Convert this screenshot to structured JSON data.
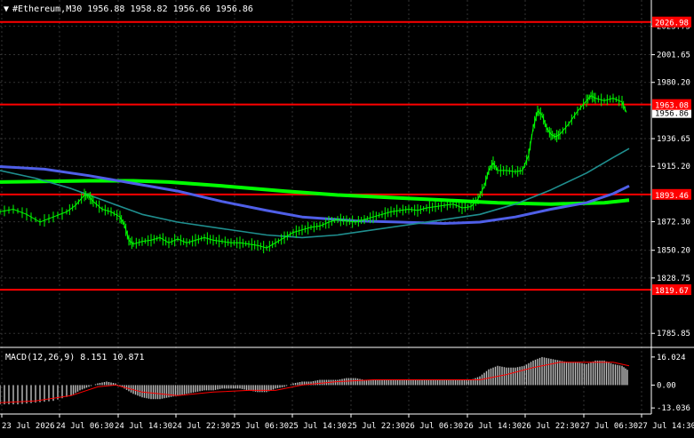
{
  "chart_data": {
    "type": "candlestick",
    "title": "#Ethereum,M30  1956.88 1958.82 1956.66 1956.86",
    "symbol": "#Ethereum",
    "timeframe": "M30",
    "ohlc": {
      "open": 1956.88,
      "high": 1958.82,
      "low": 1956.66,
      "close": 1956.86
    },
    "current_price": 1956.86,
    "ylim": [
      1775,
      2044
    ],
    "y_ticks": [
      2023.75,
      2001.65,
      1980.2,
      1936.65,
      1915.2,
      1872.3,
      1850.2,
      1828.75,
      1785.85
    ],
    "horizontal_levels": [
      {
        "label": "2026.98",
        "value": 2026.98
      },
      {
        "label": "1963.08",
        "value": 1963.08
      },
      {
        "label": "1893.46",
        "value": 1893.46
      },
      {
        "label": "1819.67",
        "value": 1819.67
      }
    ],
    "x_labels": [
      "23 Jul 2026",
      "24 Jul 06:30",
      "24 Jul 14:30",
      "24 Jul 22:30",
      "25 Jul 06:30",
      "25 Jul 14:30",
      "25 Jul 22:30",
      "26 Jul 06:30",
      "26 Jul 14:30",
      "26 Jul 22:30",
      "27 Jul 06:30",
      "27 Jul 14:30"
    ],
    "price_path": [
      [
        0,
        1880
      ],
      [
        15,
        1882
      ],
      [
        30,
        1878
      ],
      [
        45,
        1872
      ],
      [
        60,
        1876
      ],
      [
        75,
        1880
      ],
      [
        85,
        1885
      ],
      [
        95,
        1893
      ],
      [
        100,
        1892
      ],
      [
        105,
        1888
      ],
      [
        115,
        1882
      ],
      [
        125,
        1880
      ],
      [
        135,
        1876
      ],
      [
        140,
        1870
      ],
      [
        145,
        1858
      ],
      [
        150,
        1855
      ],
      [
        160,
        1857
      ],
      [
        170,
        1858
      ],
      [
        180,
        1860
      ],
      [
        190,
        1856
      ],
      [
        200,
        1859
      ],
      [
        210,
        1856
      ],
      [
        220,
        1858
      ],
      [
        230,
        1860
      ],
      [
        240,
        1858
      ],
      [
        250,
        1857
      ],
      [
        260,
        1856
      ],
      [
        270,
        1856
      ],
      [
        280,
        1855
      ],
      [
        290,
        1854
      ],
      [
        300,
        1852
      ],
      [
        310,
        1856
      ],
      [
        320,
        1860
      ],
      [
        330,
        1864
      ],
      [
        340,
        1866
      ],
      [
        350,
        1868
      ],
      [
        360,
        1869
      ],
      [
        370,
        1872
      ],
      [
        380,
        1874
      ],
      [
        390,
        1873
      ],
      [
        400,
        1872
      ],
      [
        410,
        1874
      ],
      [
        420,
        1876
      ],
      [
        430,
        1878
      ],
      [
        440,
        1880
      ],
      [
        450,
        1881
      ],
      [
        460,
        1882
      ],
      [
        470,
        1881
      ],
      [
        480,
        1883
      ],
      [
        490,
        1884
      ],
      [
        500,
        1885
      ],
      [
        510,
        1886
      ],
      [
        520,
        1883
      ],
      [
        530,
        1884
      ],
      [
        538,
        1890
      ],
      [
        545,
        1900
      ],
      [
        550,
        1912
      ],
      [
        555,
        1918
      ],
      [
        560,
        1912
      ],
      [
        570,
        1912
      ],
      [
        580,
        1911
      ],
      [
        588,
        1912
      ],
      [
        595,
        1924
      ],
      [
        600,
        1945
      ],
      [
        605,
        1958
      ],
      [
        610,
        1955
      ],
      [
        615,
        1945
      ],
      [
        620,
        1940
      ],
      [
        625,
        1938
      ],
      [
        630,
        1940
      ],
      [
        640,
        1948
      ],
      [
        650,
        1958
      ],
      [
        660,
        1966
      ],
      [
        665,
        1970
      ],
      [
        670,
        1968
      ],
      [
        680,
        1966
      ],
      [
        690,
        1968
      ],
      [
        700,
        1965
      ],
      [
        705,
        1957
      ]
    ],
    "series": [
      {
        "type": "ma",
        "color": "#00ff00",
        "points": [
          [
            0,
            1903
          ],
          [
            100,
            1904
          ],
          [
            150,
            1904
          ],
          [
            190,
            1903
          ],
          [
            250,
            1900
          ],
          [
            320,
            1896
          ],
          [
            380,
            1893
          ],
          [
            440,
            1891
          ],
          [
            500,
            1889
          ],
          [
            560,
            1887
          ],
          [
            620,
            1886
          ],
          [
            680,
            1887
          ],
          [
            708,
            1889
          ]
        ]
      },
      {
        "type": "ma",
        "color": "#4f5fe8",
        "points": [
          [
            0,
            1915
          ],
          [
            50,
            1913
          ],
          [
            100,
            1908
          ],
          [
            150,
            1902
          ],
          [
            200,
            1896
          ],
          [
            250,
            1888
          ],
          [
            300,
            1881
          ],
          [
            340,
            1876
          ],
          [
            400,
            1873
          ],
          [
            450,
            1872
          ],
          [
            500,
            1871
          ],
          [
            540,
            1872
          ],
          [
            580,
            1876
          ],
          [
            620,
            1882
          ],
          [
            660,
            1887
          ],
          [
            690,
            1894
          ],
          [
            708,
            1900
          ]
        ]
      },
      {
        "type": "ma",
        "color": "#1f8f8f",
        "points": [
          [
            0,
            1912
          ],
          [
            40,
            1906
          ],
          [
            80,
            1898
          ],
          [
            120,
            1888
          ],
          [
            160,
            1878
          ],
          [
            200,
            1872
          ],
          [
            250,
            1867
          ],
          [
            300,
            1862
          ],
          [
            340,
            1860
          ],
          [
            380,
            1862
          ],
          [
            420,
            1866
          ],
          [
            460,
            1870
          ],
          [
            500,
            1874
          ],
          [
            540,
            1878
          ],
          [
            580,
            1886
          ],
          [
            620,
            1897
          ],
          [
            660,
            1910
          ],
          [
            690,
            1922
          ],
          [
            708,
            1929
          ]
        ]
      }
    ],
    "macd": {
      "label": "MACD(12,26,9) 8.151 10.871",
      "ylim": [
        -16,
        20
      ],
      "y_ticks": [
        16.024,
        0.0,
        -13.036
      ],
      "hist": [
        [
          0,
          -11
        ],
        [
          20,
          -11
        ],
        [
          40,
          -10
        ],
        [
          60,
          -9
        ],
        [
          80,
          -6
        ],
        [
          90,
          -3
        ],
        [
          100,
          -1
        ],
        [
          110,
          1
        ],
        [
          120,
          2
        ],
        [
          130,
          1
        ],
        [
          140,
          -2
        ],
        [
          150,
          -5
        ],
        [
          160,
          -7
        ],
        [
          170,
          -8
        ],
        [
          180,
          -8
        ],
        [
          190,
          -7
        ],
        [
          200,
          -6
        ],
        [
          210,
          -5
        ],
        [
          220,
          -4
        ],
        [
          230,
          -3
        ],
        [
          240,
          -3
        ],
        [
          250,
          -2
        ],
        [
          260,
          -2
        ],
        [
          270,
          -2
        ],
        [
          280,
          -3
        ],
        [
          290,
          -4
        ],
        [
          300,
          -4
        ],
        [
          310,
          -2
        ],
        [
          320,
          -1
        ],
        [
          330,
          1
        ],
        [
          340,
          2
        ],
        [
          350,
          2
        ],
        [
          360,
          3
        ],
        [
          370,
          3
        ],
        [
          380,
          3
        ],
        [
          390,
          4
        ],
        [
          400,
          4
        ],
        [
          410,
          3
        ],
        [
          420,
          3
        ],
        [
          430,
          3
        ],
        [
          440,
          3
        ],
        [
          450,
          3
        ],
        [
          460,
          3
        ],
        [
          470,
          3
        ],
        [
          480,
          3
        ],
        [
          490,
          3
        ],
        [
          500,
          3
        ],
        [
          510,
          3
        ],
        [
          520,
          3
        ],
        [
          530,
          3
        ],
        [
          540,
          5
        ],
        [
          550,
          9
        ],
        [
          560,
          11
        ],
        [
          570,
          10
        ],
        [
          580,
          10
        ],
        [
          590,
          11
        ],
        [
          600,
          14
        ],
        [
          610,
          16
        ],
        [
          620,
          15
        ],
        [
          630,
          14
        ],
        [
          640,
          13
        ],
        [
          650,
          13
        ],
        [
          660,
          12
        ],
        [
          670,
          14
        ],
        [
          680,
          14
        ],
        [
          690,
          12
        ],
        [
          700,
          11
        ],
        [
          708,
          8
        ]
      ],
      "signal": [
        [
          0,
          -10
        ],
        [
          40,
          -9
        ],
        [
          80,
          -6
        ],
        [
          110,
          -1
        ],
        [
          130,
          0
        ],
        [
          160,
          -4
        ],
        [
          200,
          -6
        ],
        [
          240,
          -4
        ],
        [
          280,
          -3
        ],
        [
          310,
          -3
        ],
        [
          340,
          0
        ],
        [
          380,
          2
        ],
        [
          420,
          3
        ],
        [
          480,
          3
        ],
        [
          540,
          3
        ],
        [
          570,
          6
        ],
        [
          600,
          10
        ],
        [
          630,
          13
        ],
        [
          660,
          13
        ],
        [
          690,
          13
        ],
        [
          708,
          11
        ]
      ]
    }
  }
}
